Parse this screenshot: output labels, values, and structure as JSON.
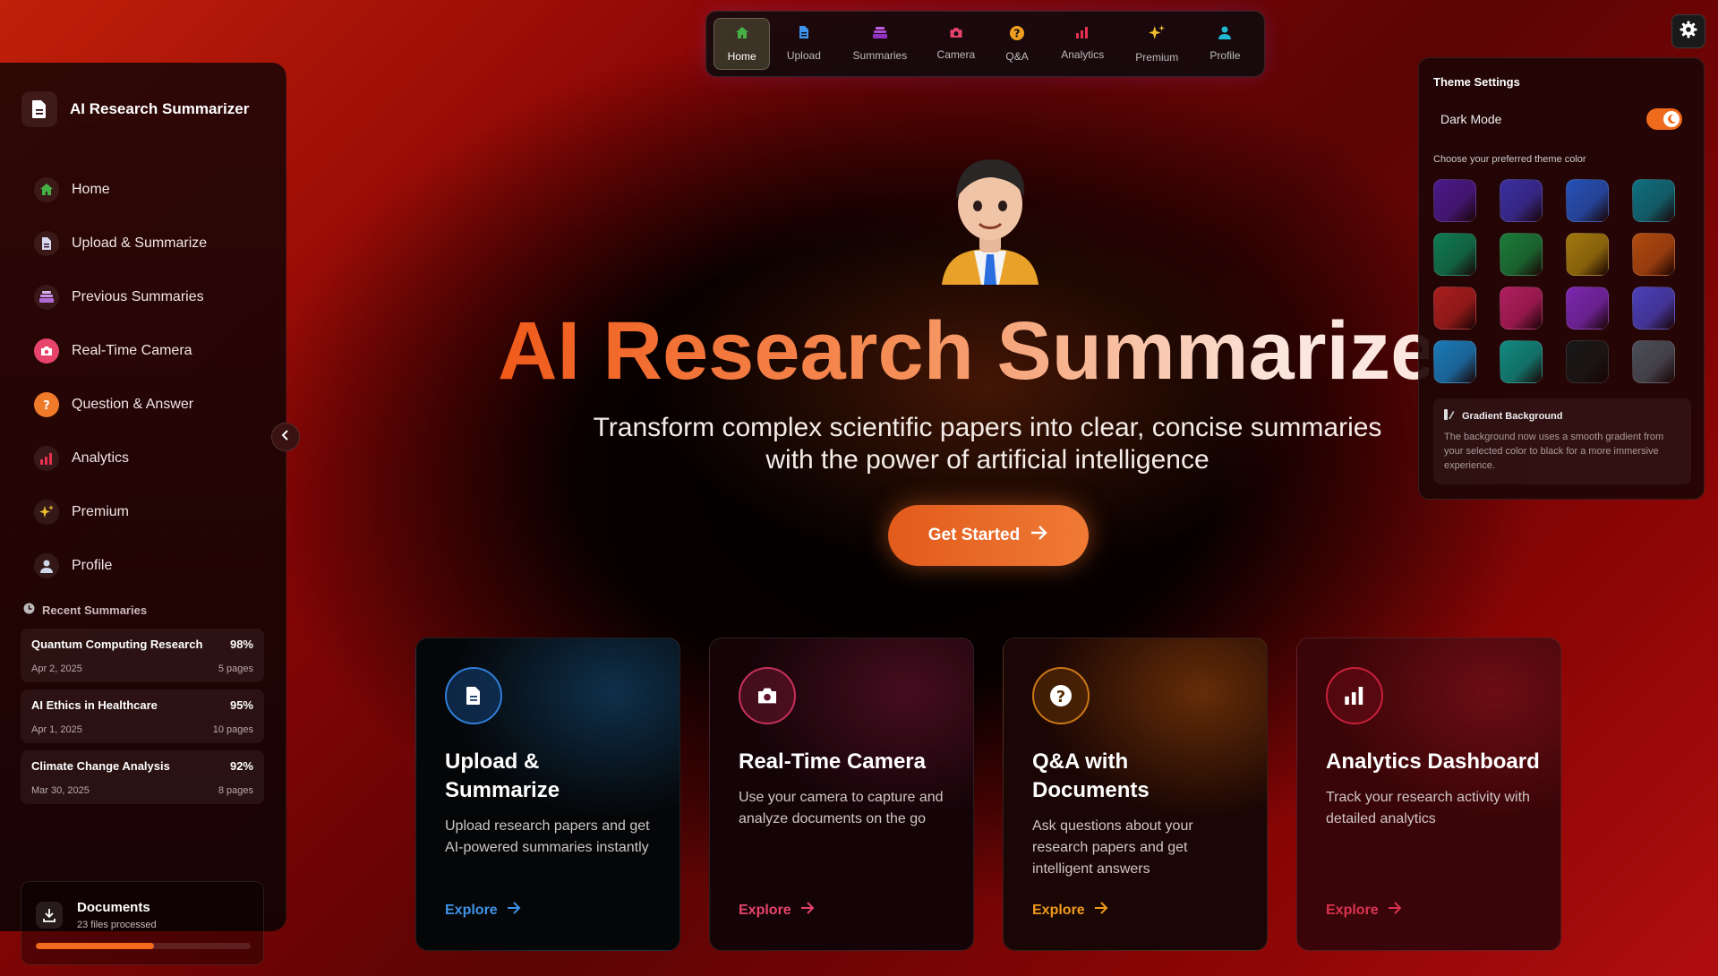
{
  "sidebar": {
    "app_title": "AI Research Summarizer",
    "items": [
      {
        "label": "Home",
        "icon": "home-icon",
        "color": "#46b046"
      },
      {
        "label": "Upload & Summarize",
        "icon": "document-icon",
        "color": "#d8d8f0"
      },
      {
        "label": "Previous Summaries",
        "icon": "stack-icon",
        "color": "#b06ad8"
      },
      {
        "label": "Real-Time Camera",
        "icon": "camera-icon",
        "color": "#e8436a"
      },
      {
        "label": "Question & Answer",
        "icon": "question-icon",
        "color": "#ef7a2a"
      },
      {
        "label": "Analytics",
        "icon": "bar-chart-icon",
        "color": "#e83050"
      },
      {
        "label": "Premium",
        "icon": "sparkles-icon",
        "color": "#f0c030"
      },
      {
        "label": "Profile",
        "icon": "user-icon",
        "color": "#cfd8e8"
      }
    ],
    "recent_heading": "Recent Summaries",
    "recent": [
      {
        "title": "Quantum Computing Research",
        "percent": "98%",
        "date": "Apr 2, 2025",
        "pages": "5 pages"
      },
      {
        "title": "AI Ethics in Healthcare",
        "percent": "95%",
        "date": "Apr 1, 2025",
        "pages": "10 pages"
      },
      {
        "title": "Climate Change Analysis",
        "percent": "92%",
        "date": "Mar 30, 2025",
        "pages": "8 pages"
      }
    ],
    "documents": {
      "title": "Documents",
      "subtitle": "23 files processed",
      "progress": 0.55
    }
  },
  "topnav": {
    "items": [
      {
        "label": "Home",
        "icon": "home-icon",
        "color": "#46b046",
        "active": true
      },
      {
        "label": "Upload",
        "icon": "document-icon",
        "color": "#3f93ea"
      },
      {
        "label": "Summaries",
        "icon": "stack-icon",
        "color": "#b04ad8"
      },
      {
        "label": "Camera",
        "icon": "camera-icon",
        "color": "#e8436a"
      },
      {
        "label": "Q&A",
        "icon": "question-icon",
        "color": "#f0a020"
      },
      {
        "label": "Analytics",
        "icon": "bar-chart-icon",
        "color": "#e83050"
      },
      {
        "label": "Premium",
        "icon": "sparkles-icon",
        "color": "#f0c030"
      },
      {
        "label": "Profile",
        "icon": "user-icon",
        "color": "#20b8d0"
      }
    ]
  },
  "hero": {
    "title": "AI Research Summarize",
    "subtitle": "Transform complex scientific papers into clear, concise summaries with the power of artificial intelligence",
    "cta": "Get Started"
  },
  "cards": [
    {
      "title": "Upload & Summarize",
      "description": "Upload research papers and get AI-powered summaries instantly",
      "link": "Explore",
      "icon": "document-icon"
    },
    {
      "title": "Real-Time Camera",
      "description": "Use your camera to capture and analyze documents on the go",
      "link": "Explore",
      "icon": "camera-icon"
    },
    {
      "title": "Q&A with Documents",
      "description": "Ask questions about your research papers and get intelligent answers",
      "link": "Explore",
      "icon": "question-icon"
    },
    {
      "title": "Analytics Dashboard",
      "description": "Track your research activity with detailed analytics",
      "link": "Explore",
      "icon": "bar-chart-icon"
    }
  ],
  "theme": {
    "title": "Theme Settings",
    "dark_mode_label": "Dark Mode",
    "dark_mode_on": true,
    "choose_label": "Choose your preferred theme color",
    "swatches": [
      "#4a1a8a",
      "#3a2fa0",
      "#2552b8",
      "#0f6f7e",
      "#0f7a52",
      "#1a7a3a",
      "#a0780e",
      "#b04a10",
      "#a81e1e",
      "#b01e5e",
      "#7a28b0",
      "#4a40b8",
      "#1a7ab8",
      "#108a80",
      "#181818",
      "#4a4e58"
    ],
    "note_title": "Gradient Background",
    "note_text": "The background now uses a smooth gradient from your selected color to black for a more immersive experience."
  }
}
